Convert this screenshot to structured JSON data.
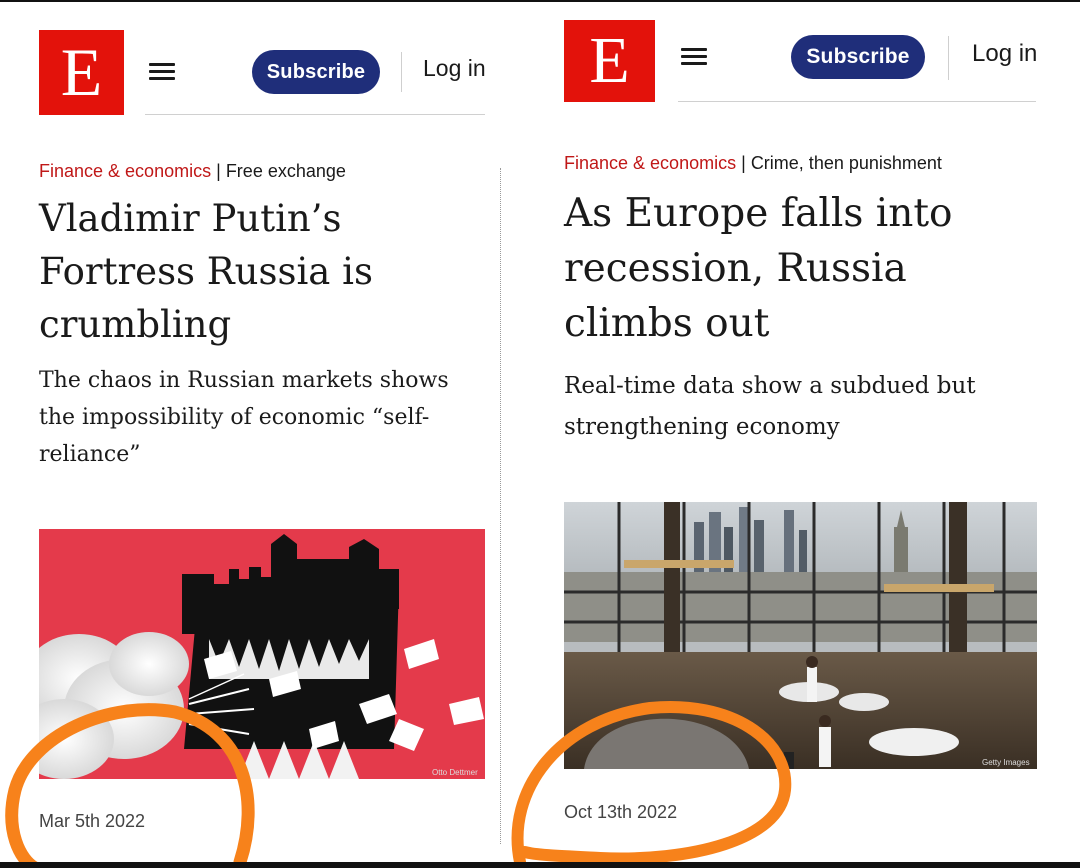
{
  "left_article": {
    "logo_letter": "E",
    "subscribe_label": "Subscribe",
    "login_label": "Log in",
    "section": "Finance & economics",
    "separator": "|",
    "flytitle": "Free exchange",
    "headline": "Vladimir Putin’s Fortress Russia is crumbling",
    "dek": "The chaos in Russian markets shows the impossibility of economic “self-reliance”",
    "image_credit": "Otto Dettmer",
    "date": "Mar 5th 2022"
  },
  "right_article": {
    "logo_letter": "E",
    "subscribe_label": "Subscribe",
    "login_label": "Log in",
    "section": "Finance & economics",
    "separator": "|",
    "flytitle": "Crime, then punishment",
    "headline": "As Europe falls into recession, Russia climbs out",
    "dek": "Real-time data show a subdued but strengthening economy",
    "image_credit": "Getty Images",
    "date": "Oct 13th 2022"
  },
  "colors": {
    "brand_red": "#e3120b",
    "subscribe_blue": "#1f2e7a",
    "section_red": "#c01818",
    "annotation_orange": "#f7821b",
    "illustration_red": "#e43a4b"
  },
  "icons": [
    "hamburger-menu-icon"
  ]
}
